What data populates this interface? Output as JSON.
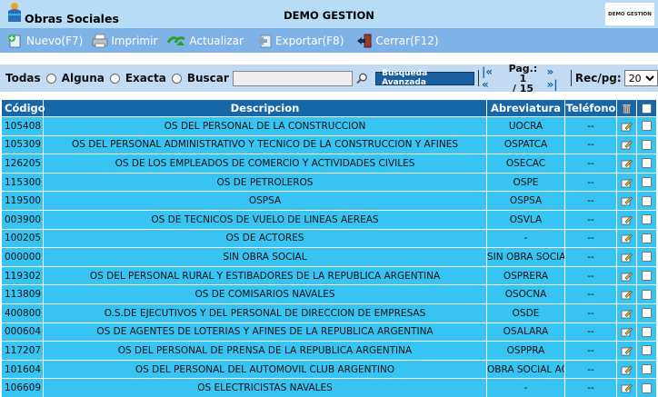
{
  "header": {
    "app_title": "Obras Sociales",
    "center_title": "DEMO GESTION",
    "brand_logo": "DEMO GESTION"
  },
  "toolbar": {
    "items": [
      {
        "label": "Nuevo(F7)",
        "icon": "add-icon"
      },
      {
        "label": "Imprimir",
        "icon": "printer-icon"
      },
      {
        "label": "Actualizar",
        "icon": "refresh-icon"
      },
      {
        "label": "Exportar(F8)",
        "icon": "export-icon"
      },
      {
        "label": "Cerrar(F12)",
        "icon": "exit-icon"
      }
    ]
  },
  "search": {
    "options": [
      "Todas",
      "Alguna",
      "Exacta"
    ],
    "buscar_label": "Buscar",
    "input_value": "",
    "advanced_button": "Busqueda Avanzada",
    "nav_prev": "|« «",
    "page_line1": "Pag.: 1",
    "page_line2": "/ 15",
    "nav_next": "» »|",
    "records_label": "Rec/pg:",
    "records_value": "20"
  },
  "table": {
    "headers": {
      "code": "Código",
      "description": "Descripcion",
      "abbreviation": "Abreviatura",
      "phone": "Teléfono"
    },
    "rows": [
      {
        "code": "105408",
        "description": "OS DEL PERSONAL DE LA CONSTRUCCION",
        "abbreviation": "UOCRA",
        "phone": "--"
      },
      {
        "code": "105309",
        "description": "OS DEL PERSONAL ADMINISTRATIVO Y TECNICO DE LA CONSTRUCCION Y AFINES",
        "abbreviation": "OSPATCA",
        "phone": "--"
      },
      {
        "code": "126205",
        "description": "OS DE LOS EMPLEADOS DE COMERCIO Y ACTIVIDADES CIVILES",
        "abbreviation": "OSECAC",
        "phone": "--"
      },
      {
        "code": "115300",
        "description": "OS DE PETROLEROS",
        "abbreviation": "OSPE",
        "phone": "--"
      },
      {
        "code": "119500",
        "description": "OSPSA",
        "abbreviation": "OSPSA",
        "phone": "--"
      },
      {
        "code": "003900",
        "description": "OS DE TECNICOS DE VUELO DE LINEAS AEREAS",
        "abbreviation": "OSVLA",
        "phone": "--"
      },
      {
        "code": "100205",
        "description": "OS DE ACTORES",
        "abbreviation": "-",
        "phone": "--"
      },
      {
        "code": "000000",
        "description": "SIN OBRA SOCIAL",
        "abbreviation": "SIN OBRA SOCIAL",
        "phone": "--"
      },
      {
        "code": "119302",
        "description": "OS DEL PERSONAL RURAL Y ESTIBADORES DE LA REPUBLICA ARGENTINA",
        "abbreviation": "OSPRERA",
        "phone": "--"
      },
      {
        "code": "113809",
        "description": "OS DE COMISARIOS NAVALES",
        "abbreviation": "OSOCNA",
        "phone": "--"
      },
      {
        "code": "400800",
        "description": "O.S.DE EJECUTIVOS Y DEL PERSONAL DE DIRECCION DE EMPRESAS",
        "abbreviation": "OSDE",
        "phone": "--"
      },
      {
        "code": "000604",
        "description": "OS DE AGENTES DE LOTERIAS Y AFINES DE LA REPUBLICA ARGENTINA",
        "abbreviation": "OSALARA",
        "phone": "--"
      },
      {
        "code": "117207",
        "description": "OS DEL PERSONAL DE PRENSA DE LA REPUBLICA ARGENTINA",
        "abbreviation": "OSPPRA",
        "phone": "--"
      },
      {
        "code": "101604",
        "description": "OS DEL PERSONAL DEL AUTOMOVIL CLUB ARGENTINO",
        "abbreviation": "OBRA SOCIAL ACA",
        "phone": "--"
      },
      {
        "code": "106609",
        "description": "OS ELECTRICISTAS NAVALES",
        "abbreviation": "-",
        "phone": "--"
      }
    ]
  },
  "colors": {
    "header_bg": "#b9dcf6",
    "toolbar_bg": "#7fb3e8",
    "table_header_bg": "#1667a8",
    "row_bg": "#37c4f2"
  }
}
